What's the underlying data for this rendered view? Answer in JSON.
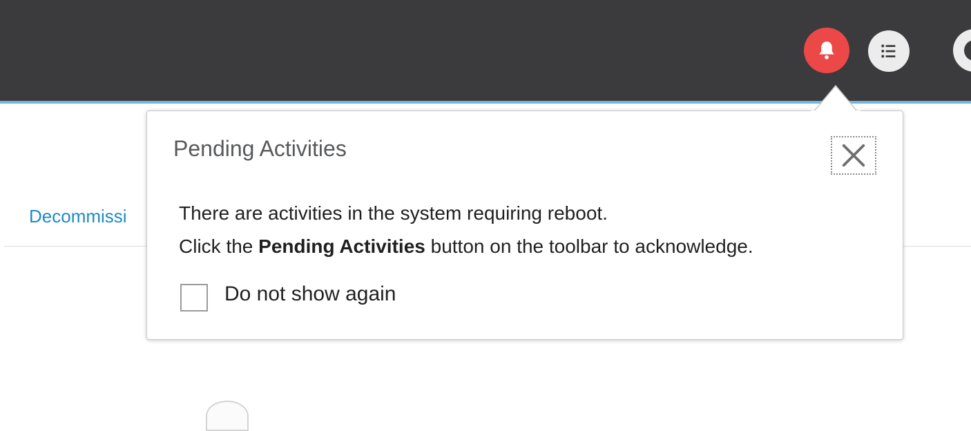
{
  "toolbar": {
    "bell_icon": "bell-icon",
    "list_icon": "list-icon",
    "cut_icon": "settings-icon",
    "colors": {
      "bar": "#3b3a3c",
      "accent": "#6fb6de",
      "alert": "#ec4848"
    }
  },
  "page": {
    "decommission_link": "Decommissi"
  },
  "popover": {
    "title": "Pending Activities",
    "line1": "There are activities in the system requiring reboot.",
    "line2_prefix": "Click the ",
    "line2_bold": "Pending Activities",
    "line2_suffix": " button on the toolbar to acknowledge.",
    "checkbox_label": "Do not show again",
    "checkbox_checked": false,
    "close_icon": "close-icon"
  }
}
